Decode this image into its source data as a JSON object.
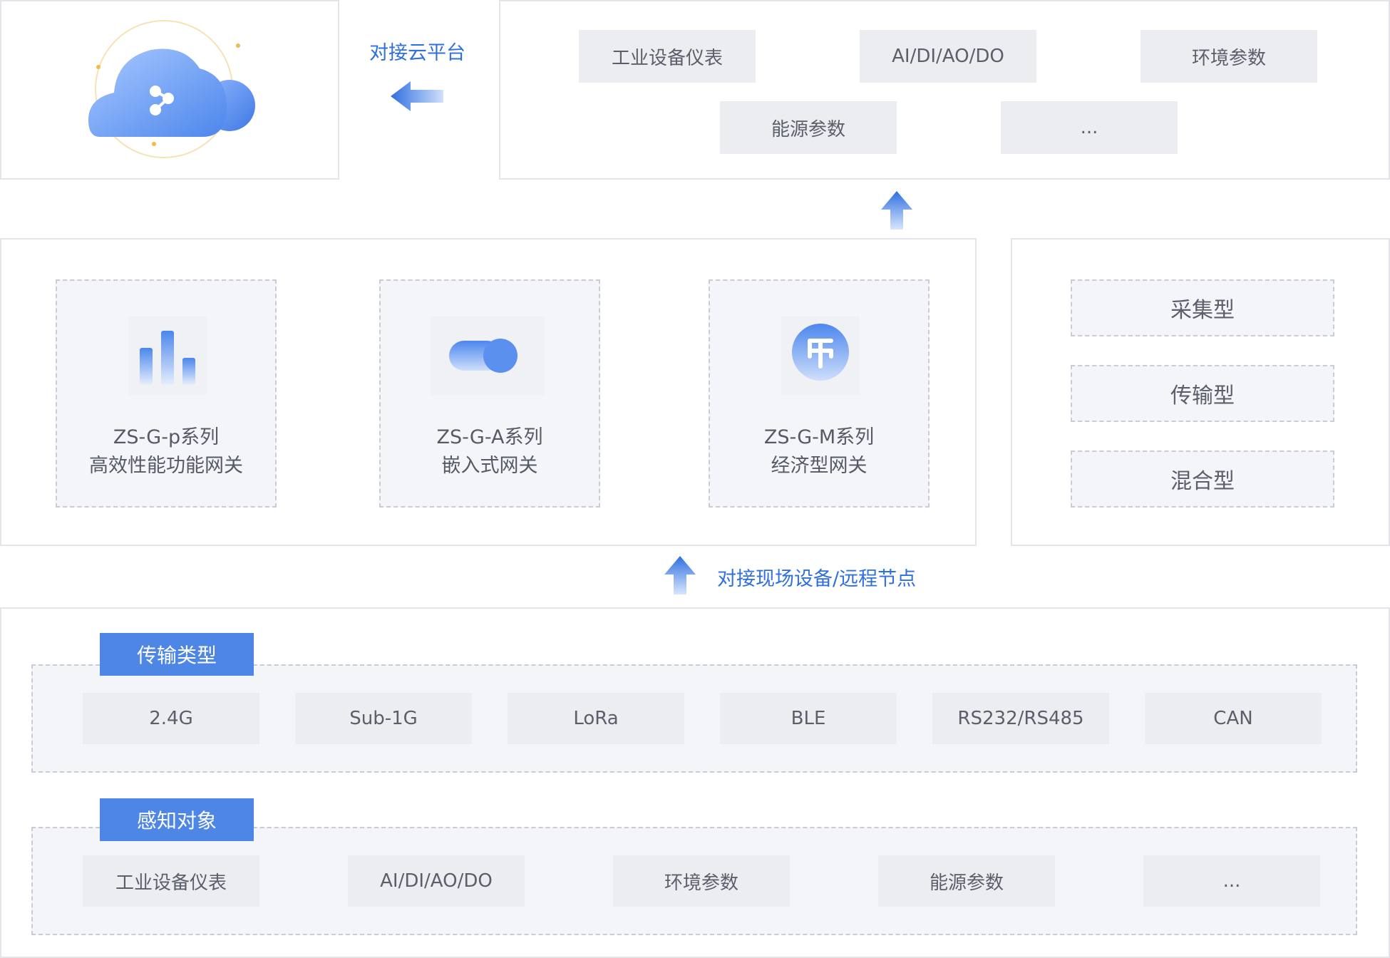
{
  "colors": {
    "accent": "#4e86e6",
    "link": "#2f6fe0",
    "chip": "#ecedf1"
  },
  "top": {
    "cloud_label": "对接云平台",
    "devices": [
      "工业设备仪表",
      "AI/DI/AO/DO",
      "环境参数",
      "能源参数",
      "..."
    ]
  },
  "gateways": [
    {
      "line1": "ZS-G-p系列",
      "line2": "高效性能功能网关",
      "icon": "bar-chart-icon"
    },
    {
      "line1": "ZS-G-A系列",
      "line2": "嵌入式网关",
      "icon": "toggle-icon"
    },
    {
      "line1": "ZS-G-M系列",
      "line2": "经济型网关",
      "icon": "coin-icon"
    }
  ],
  "types": [
    "采集型",
    "传输型",
    "混合型"
  ],
  "field_label": "对接现场设备/远程节点",
  "transport": {
    "tag": "传输类型",
    "items": [
      "2.4G",
      "Sub-1G",
      "LoRa",
      "BLE",
      "RS232/RS485",
      "CAN"
    ]
  },
  "sensing": {
    "tag": "感知对象",
    "items": [
      "工业设备仪表",
      "AI/DI/AO/DO",
      "环境参数",
      "能源参数",
      "..."
    ]
  }
}
